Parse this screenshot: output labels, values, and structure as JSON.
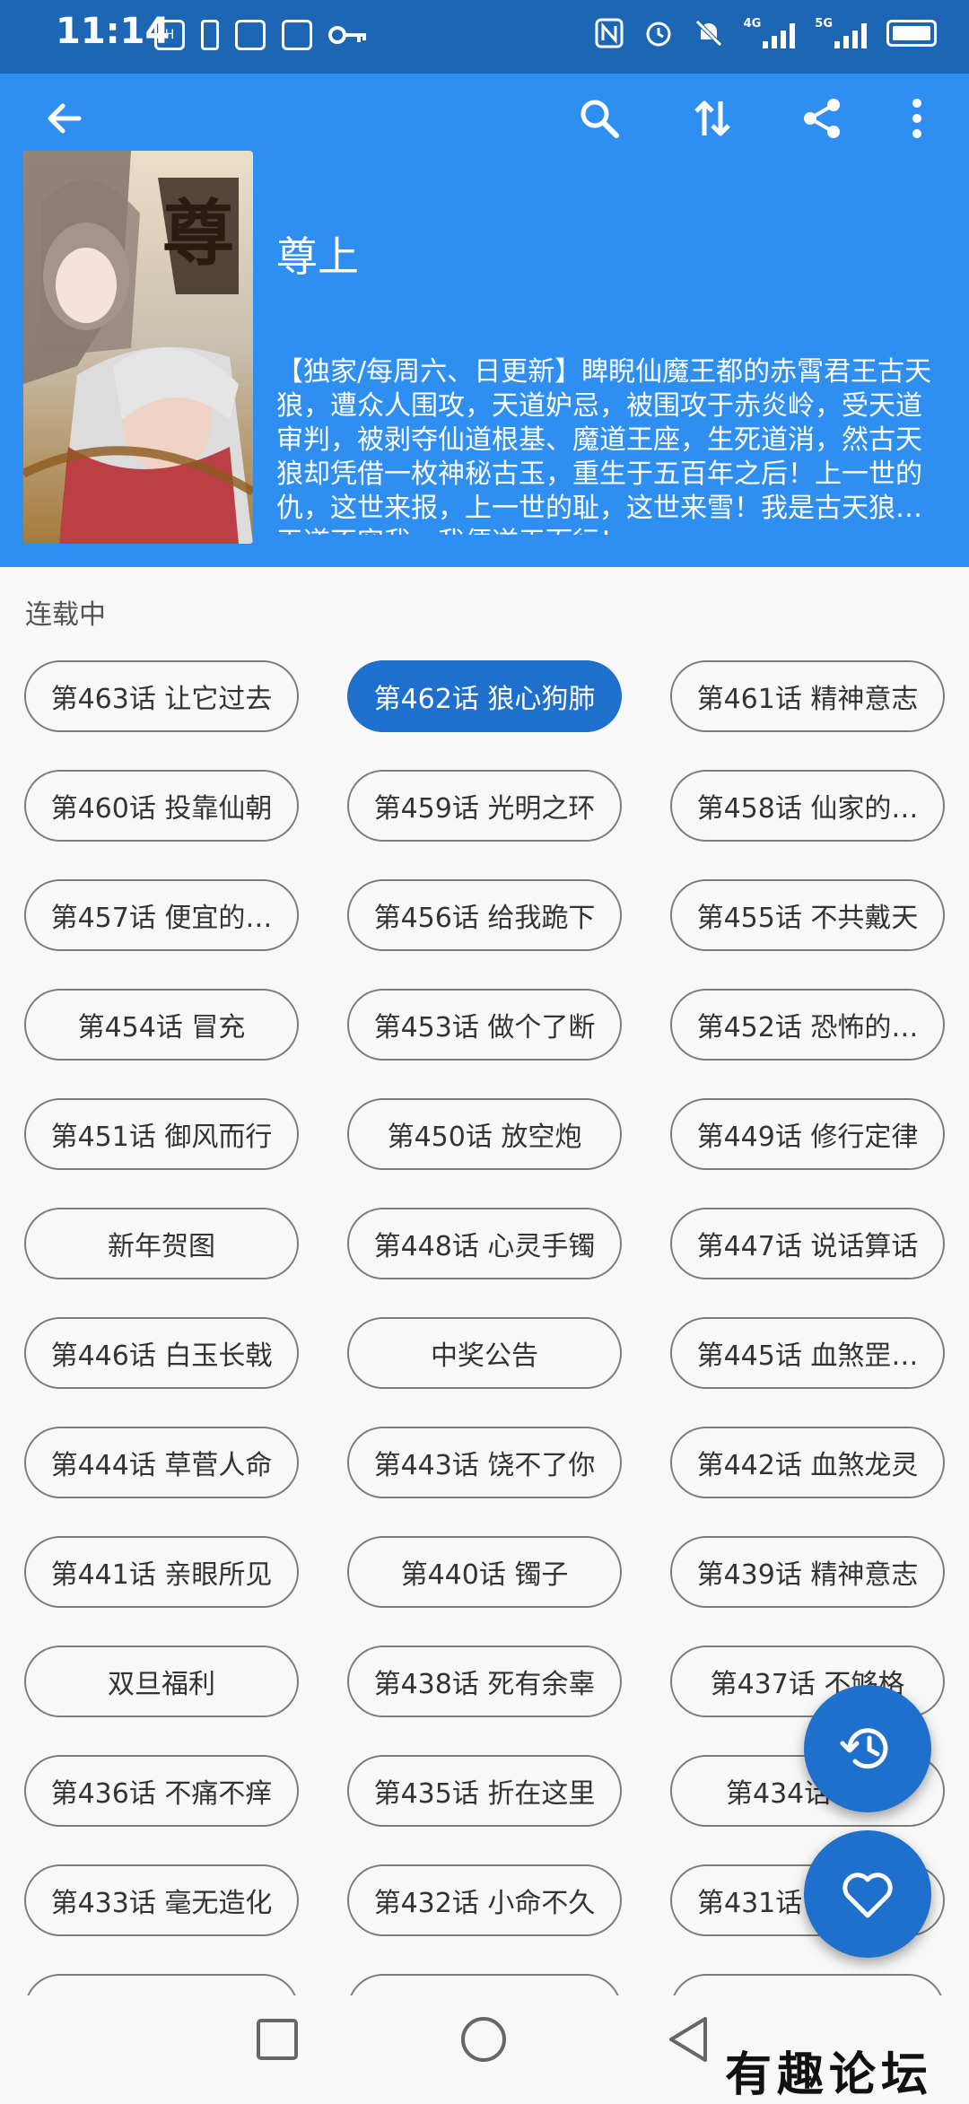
{
  "status_bar": {
    "time": "11:14",
    "left_icons": [
      "hmos-icon",
      "alert-icon",
      "tieba-icon",
      "vpn-icon",
      "key-icon"
    ],
    "right_icons": [
      "nfc-icon",
      "alarm-icon",
      "mute-icon",
      "signal-4g-icon",
      "signal-5g-icon",
      "battery-icon"
    ],
    "signal_4g": "4G",
    "signal_5g": "5G"
  },
  "toolbar": {
    "back_icon": "arrow-back-icon",
    "search_icon": "search-icon",
    "sort_icon": "swap-vertical-icon",
    "share_icon": "share-icon",
    "more_icon": "more-vertical-icon"
  },
  "comic": {
    "title": "尊上",
    "description": "【独家/每周六、日更新】睥睨仙魔王都的赤霄君王古天狼，遭众人围攻，天道妒忌，被围攻于赤炎岭，受天道审判，被剥夺仙道根基、魔道王座，生死道消，然古天狼却凭借一枚神秘古玉，重生于五百年之后！上一世的仇，这世来报，上一世的耻，这世来雪！我是古天狼，天道不容我，我便逆天而行！"
  },
  "serial_status": "连载中",
  "chapters": [
    {
      "label": "第463话 让它过去",
      "active": false
    },
    {
      "label": "第462话 狼心狗肺",
      "active": true
    },
    {
      "label": "第461话 精神意志",
      "active": false
    },
    {
      "label": "第460话 投靠仙朝",
      "active": false
    },
    {
      "label": "第459话 光明之环",
      "active": false
    },
    {
      "label": "第458话 仙家的…",
      "active": false
    },
    {
      "label": "第457话 便宜的…",
      "active": false
    },
    {
      "label": "第456话 给我跪下",
      "active": false
    },
    {
      "label": "第455话 不共戴天",
      "active": false
    },
    {
      "label": "第454话 冒充",
      "active": false
    },
    {
      "label": "第453话 做个了断",
      "active": false
    },
    {
      "label": "第452话 恐怖的…",
      "active": false
    },
    {
      "label": "第451话 御风而行",
      "active": false
    },
    {
      "label": "第450话 放空炮",
      "active": false
    },
    {
      "label": "第449话 修行定律",
      "active": false
    },
    {
      "label": "新年贺图",
      "active": false
    },
    {
      "label": "第448话 心灵手镯",
      "active": false
    },
    {
      "label": "第447话 说话算话",
      "active": false
    },
    {
      "label": "第446话 白玉长戟",
      "active": false
    },
    {
      "label": "中奖公告",
      "active": false
    },
    {
      "label": "第445话 血煞罡…",
      "active": false
    },
    {
      "label": "第444话 草菅人命",
      "active": false
    },
    {
      "label": "第443话 饶不了你",
      "active": false
    },
    {
      "label": "第442话 血煞龙灵",
      "active": false
    },
    {
      "label": "第441话 亲眼所见",
      "active": false
    },
    {
      "label": "第440话 镯子",
      "active": false
    },
    {
      "label": "第439话 精神意志",
      "active": false
    },
    {
      "label": "双旦福利",
      "active": false
    },
    {
      "label": "第438话 死有余辜",
      "active": false
    },
    {
      "label": "第437话 不够格",
      "active": false
    },
    {
      "label": "第436话 不痛不痒",
      "active": false
    },
    {
      "label": "第435话 折在这里",
      "active": false
    },
    {
      "label": "第434话",
      "active": false
    },
    {
      "label": "第433话 毫无造化",
      "active": false
    },
    {
      "label": "第432话 小命不久",
      "active": false
    },
    {
      "label": "第431话",
      "active": false
    },
    {
      "label": "",
      "active": false
    },
    {
      "label": "",
      "active": false
    },
    {
      "label": "",
      "active": false
    }
  ],
  "fab": {
    "history_icon": "history-icon",
    "favorite_icon": "heart-icon"
  },
  "navbar": {
    "recents_icon": "square-icon",
    "home_icon": "circle-icon",
    "back_icon": "triangle-back-icon"
  },
  "watermark": "有趣论坛",
  "colors": {
    "status_bar": "#1d66b4",
    "app_bar": "#2f8ff0",
    "accent": "#1f6fcc",
    "background": "#f8f8f8"
  }
}
